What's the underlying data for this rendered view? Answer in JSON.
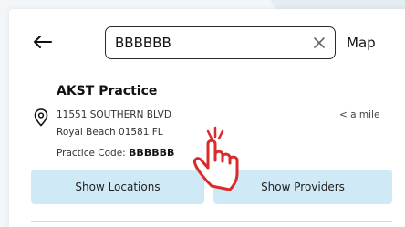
{
  "search": {
    "value": "BBBBBB",
    "placeholder": ""
  },
  "header": {
    "map_label": "Map"
  },
  "practice": {
    "name": "AKST Practice",
    "address_line1": "11551 SOUTHERN BLVD",
    "address_line2": "Royal Beach 01581 FL",
    "distance": "< a mile",
    "code_label": "Practice Code:",
    "code_value": "BBBBBB"
  },
  "actions": {
    "show_locations": "Show Locations",
    "show_providers": "Show Providers"
  },
  "colors": {
    "button_bg": "#cfe9f6",
    "hand_outline": "#d92b2b"
  },
  "icons": [
    "back-arrow-icon",
    "clear-icon",
    "location-pin-icon",
    "pointing-hand-icon"
  ]
}
